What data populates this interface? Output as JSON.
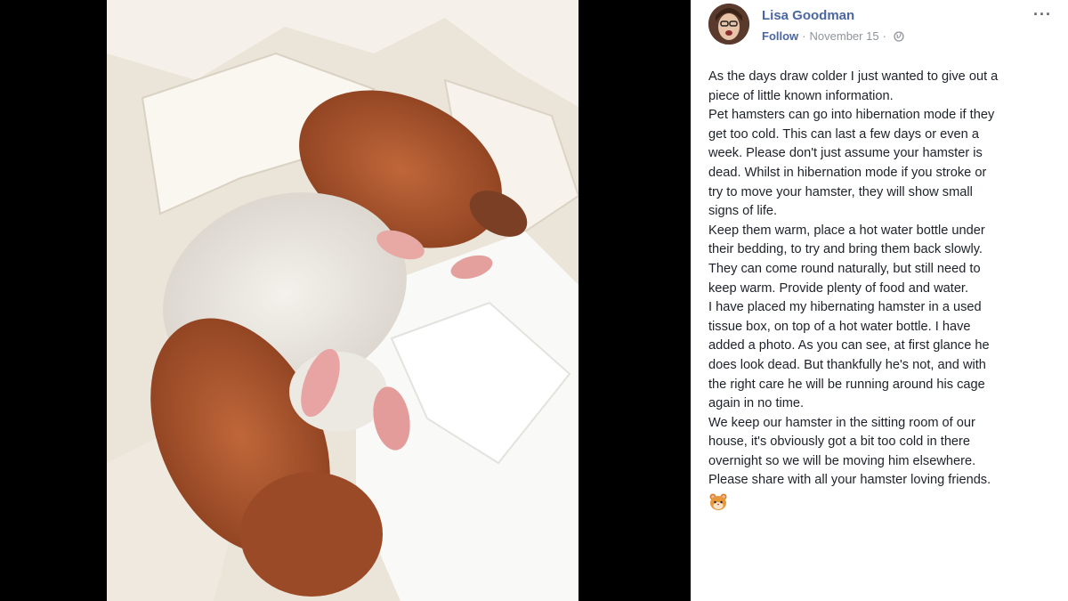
{
  "post": {
    "author": "Lisa Goodman",
    "follow_label": "Follow",
    "separator": "·",
    "date": "November 15",
    "separator2": "·",
    "more_label": "···",
    "lines": [
      "As the days draw colder I just wanted to give out a",
      "piece of little known information.",
      "Pet hamsters can go into hibernation mode if they",
      "get too cold. This can last a few days or even a",
      "week. Please don't just assume your hamster is",
      "dead. Whilst in hibernation mode if you stroke or",
      "try to move your hamster, they will show small",
      "signs of life.",
      "Keep them warm, place a hot water bottle under",
      "their bedding, to try and bring them back slowly.",
      "They can come round naturally, but still need to",
      "keep warm. Provide plenty of food and water.",
      "I have placed my hibernating hamster in a used",
      "tissue box, on top of a hot water bottle. I have",
      "added a photo. As you can see, at first glance he",
      "does look dead. But thankfully he's not, and with",
      "the right care he will be running around his cage",
      "again in no time.",
      "We keep our hamster in the sitting room of our",
      "house, it's obviously got a bit too cold in there",
      "overnight so we will be moving him elsewhere.",
      "Please share with all your hamster loving friends."
    ],
    "emoji_icon": "hamster-face-emoji",
    "privacy_icon": "globe-icon"
  },
  "colors": {
    "link_blue": "#4b67a1",
    "meta_gray": "#90949c",
    "text": "#1d2129",
    "backdrop": "#000000"
  }
}
